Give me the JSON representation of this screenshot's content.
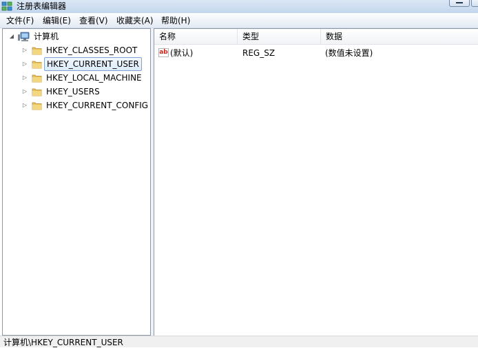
{
  "window": {
    "title": "注册表编辑器"
  },
  "menu": [
    "文件(F)",
    "编辑(E)",
    "查看(V)",
    "收藏夹(A)",
    "帮助(H)"
  ],
  "tree": {
    "root_label": "计算机",
    "keys": [
      {
        "label": "HKEY_CLASSES_ROOT",
        "selected": false
      },
      {
        "label": "HKEY_CURRENT_USER",
        "selected": true
      },
      {
        "label": "HKEY_LOCAL_MACHINE",
        "selected": false
      },
      {
        "label": "HKEY_USERS",
        "selected": false
      },
      {
        "label": "HKEY_CURRENT_CONFIG",
        "selected": false
      }
    ]
  },
  "list": {
    "columns": [
      "名称",
      "类型",
      "数据"
    ],
    "rows": [
      {
        "name": "(默认)",
        "type": "REG_SZ",
        "data": "(数值未设置)",
        "icon": "string-value-icon"
      }
    ]
  },
  "status": {
    "path": "计算机\\HKEY_CURRENT_USER"
  },
  "colors": {
    "selection_border": "#7da2ce",
    "selection_fill": "#dcebfc",
    "folder": "#e8c25a"
  }
}
